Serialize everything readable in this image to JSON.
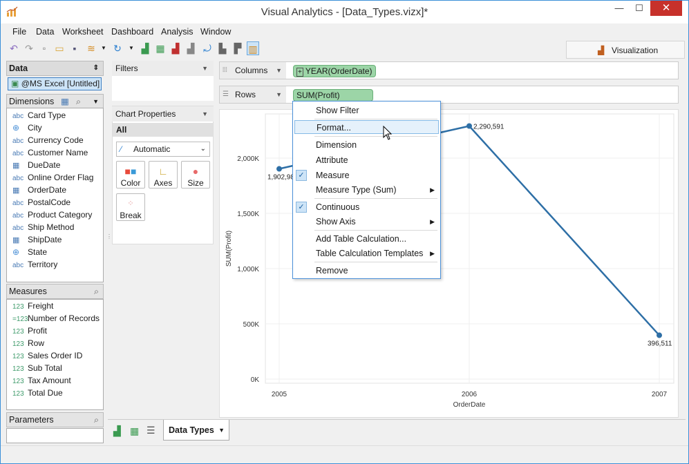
{
  "window": {
    "title": "Visual Analytics - [Data_Types.vizx]*",
    "min": "—",
    "max": "☐",
    "close": "✕"
  },
  "menu": [
    "File",
    "Data",
    "Worksheet",
    "Dashboard",
    "Analysis",
    "Window"
  ],
  "viz_tab": {
    "label": "Visualization"
  },
  "data_panel": {
    "header": "Data",
    "datasource": "@MS Excel [Untitled]",
    "dimensions_header": "Dimensions",
    "dimensions": [
      {
        "icon": "abc",
        "label": "Card Type"
      },
      {
        "icon": "geo",
        "label": "City"
      },
      {
        "icon": "abc",
        "label": "Currency Code"
      },
      {
        "icon": "abc",
        "label": "Customer Name"
      },
      {
        "icon": "date",
        "label": "DueDate"
      },
      {
        "icon": "abc",
        "label": "Online Order Flag"
      },
      {
        "icon": "date",
        "label": "OrderDate"
      },
      {
        "icon": "abc",
        "label": "PostalCode"
      },
      {
        "icon": "abc",
        "label": "Product Category"
      },
      {
        "icon": "abc",
        "label": "Ship Method"
      },
      {
        "icon": "date",
        "label": "ShipDate"
      },
      {
        "icon": "geo",
        "label": "State"
      },
      {
        "icon": "abc",
        "label": "Territory"
      }
    ],
    "measures_header": "Measures",
    "measures": [
      {
        "icon": "123",
        "label": "Freight"
      },
      {
        "icon": "=123",
        "label": "Number of Records"
      },
      {
        "icon": "123",
        "label": "Profit"
      },
      {
        "icon": "123",
        "label": "Row"
      },
      {
        "icon": "123",
        "label": "Sales Order ID"
      },
      {
        "icon": "123",
        "label": "Sub Total"
      },
      {
        "icon": "123",
        "label": "Tax Amount"
      },
      {
        "icon": "123",
        "label": "Total Due"
      }
    ],
    "parameters_header": "Parameters"
  },
  "filters": {
    "header": "Filters"
  },
  "chart_properties": {
    "header": "Chart Properties",
    "all_label": "All",
    "mark_type": "Automatic",
    "buttons": [
      "Color",
      "Axes",
      "Size",
      "Break"
    ]
  },
  "shelves": {
    "columns_label": "Columns",
    "columns_pill": "YEAR(OrderDate)",
    "rows_label": "Rows",
    "rows_pill": "SUM(Profit)"
  },
  "context_menu": {
    "items": [
      {
        "label": "Show Filter"
      },
      {
        "label": "Format...",
        "highlighted": true
      },
      {
        "label": "Dimension"
      },
      {
        "label": "Attribute"
      },
      {
        "label": "Measure",
        "checked": true
      },
      {
        "label": "Measure Type (Sum)",
        "submenu": true
      },
      {
        "label": "Continuous",
        "checked": true
      },
      {
        "label": "Show Axis",
        "submenu": true
      },
      {
        "label": "Add Table Calculation..."
      },
      {
        "label": "Table Calculation Templates",
        "submenu": true
      },
      {
        "label": "Remove"
      }
    ]
  },
  "chart_data": {
    "type": "line",
    "x": [
      "2005",
      "2006",
      "2007"
    ],
    "series": [
      {
        "values": [
          1902980,
          2290591,
          396511
        ],
        "labels": [
          "1,902,98",
          "2,290,591",
          "396,511"
        ]
      }
    ],
    "xlabel": "OrderDate",
    "ylabel": "SUM(Profit)",
    "yticks": [
      "0K",
      "500K",
      "1,000K",
      "1,500K",
      "2,000K"
    ],
    "ytick_values": [
      0,
      500000,
      1000000,
      1500000,
      2000000
    ],
    "ylim": [
      0,
      2400000
    ],
    "color": "#2e6fa6",
    "grid": true
  },
  "sheet_tab": {
    "label": "Data Types"
  }
}
